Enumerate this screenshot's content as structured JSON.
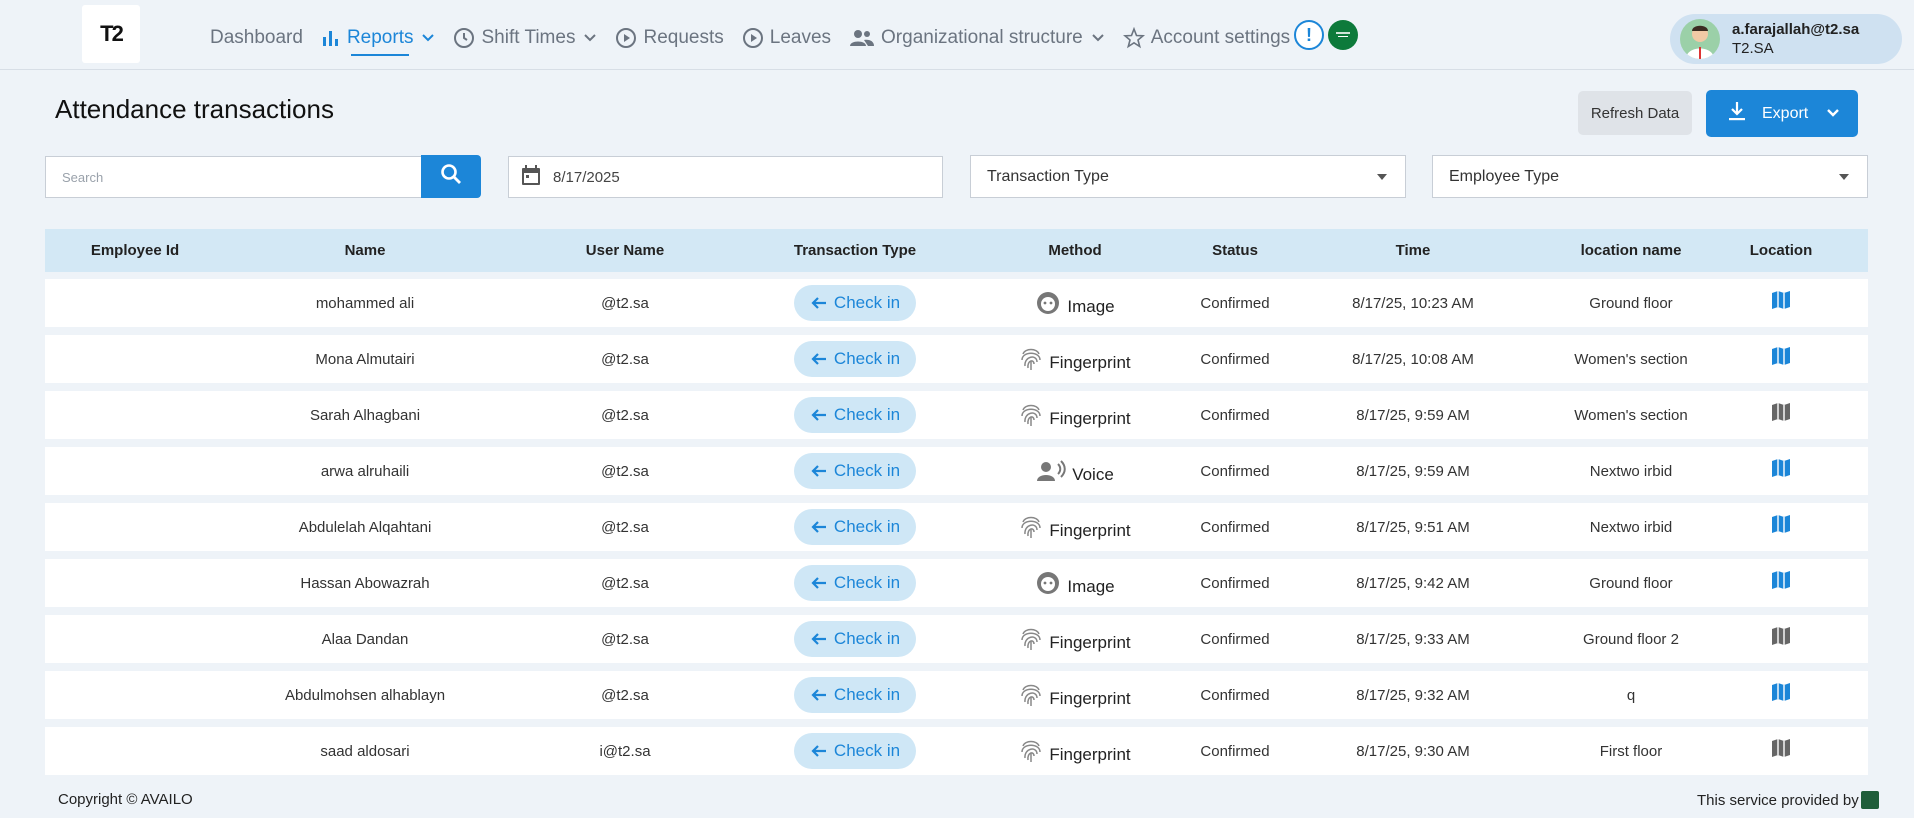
{
  "header": {
    "logo_text": "T2",
    "nav": [
      {
        "label": "Dashboard"
      },
      {
        "label": "Reports"
      },
      {
        "label": "Shift Times"
      },
      {
        "label": "Requests"
      },
      {
        "label": "Leaves"
      },
      {
        "label": "Organizational structure"
      },
      {
        "label": "Account settings"
      }
    ],
    "alert_symbol": "!",
    "user": {
      "email": "a.farajallah@t2.sa",
      "domain": "T2.SA"
    }
  },
  "page": {
    "title": "Attendance transactions",
    "refresh_label": "Refresh Data",
    "export_label": "Export"
  },
  "filters": {
    "search_placeholder": "Search",
    "date_value": "8/17/2025",
    "transaction_type_label": "Transaction Type",
    "employee_type_label": "Employee Type"
  },
  "table": {
    "columns": [
      "Employee Id",
      "Name",
      "User Name",
      "Transaction Type",
      "Method",
      "Status",
      "Time",
      "location name",
      "Location"
    ],
    "rows": [
      {
        "employee_id": "",
        "name": "mohammed ali",
        "username": "@t2.sa",
        "type": "Check in",
        "method": "Image",
        "method_icon": "face-icon",
        "status": "Confirmed",
        "time": "8/17/25, 10:23 AM",
        "location_name": "Ground floor",
        "location_icon": "map-icon",
        "location_color": "#1c86d8"
      },
      {
        "employee_id": "",
        "name": "Mona Almutairi",
        "username": "@t2.sa",
        "type": "Check in",
        "method": "Fingerprint",
        "method_icon": "fingerprint-icon",
        "status": "Confirmed",
        "time": "8/17/25, 10:08 AM",
        "location_name": "Women's section",
        "location_icon": "map-icon",
        "location_color": "#1c86d8"
      },
      {
        "employee_id": "",
        "name": "Sarah Alhagbani",
        "username": "@t2.sa",
        "type": "Check in",
        "method": "Fingerprint",
        "method_icon": "fingerprint-icon",
        "status": "Confirmed",
        "time": "8/17/25, 9:59 AM",
        "location_name": "Women's section",
        "location_icon": "map-icon",
        "location_color": "#666666"
      },
      {
        "employee_id": "",
        "name": "arwa alruhaili",
        "username": "@t2.sa",
        "type": "Check in",
        "method": "Voice",
        "method_icon": "voice-icon",
        "status": "Confirmed",
        "time": "8/17/25, 9:59 AM",
        "location_name": "Nextwo irbid",
        "location_icon": "map-icon",
        "location_color": "#1c86d8"
      },
      {
        "employee_id": "",
        "name": "Abdulelah Alqahtani",
        "username": "@t2.sa",
        "type": "Check in",
        "method": "Fingerprint",
        "method_icon": "fingerprint-icon",
        "status": "Confirmed",
        "time": "8/17/25, 9:51 AM",
        "location_name": "Nextwo irbid",
        "location_icon": "map-icon",
        "location_color": "#1c86d8"
      },
      {
        "employee_id": "",
        "name": "Hassan Abowazrah",
        "username": "@t2.sa",
        "type": "Check in",
        "method": "Image",
        "method_icon": "face-icon",
        "status": "Confirmed",
        "time": "8/17/25, 9:42 AM",
        "location_name": "Ground floor",
        "location_icon": "map-icon",
        "location_color": "#1c86d8"
      },
      {
        "employee_id": "",
        "name": "Alaa Dandan",
        "username": "@t2.sa",
        "type": "Check in",
        "method": "Fingerprint",
        "method_icon": "fingerprint-icon",
        "status": "Confirmed",
        "time": "8/17/25, 9:33 AM",
        "location_name": "Ground floor 2",
        "location_icon": "map-icon",
        "location_color": "#666666"
      },
      {
        "employee_id": "",
        "name": "Abdulmohsen alhablayn",
        "username": "@t2.sa",
        "type": "Check in",
        "method": "Fingerprint",
        "method_icon": "fingerprint-icon",
        "status": "Confirmed",
        "time": "8/17/25, 9:32 AM",
        "location_name": "q",
        "location_icon": "map-icon",
        "location_color": "#1c86d8"
      },
      {
        "employee_id": "",
        "name": "saad aldosari",
        "username": "i@t2.sa",
        "type": "Check in",
        "method": "Fingerprint",
        "method_icon": "fingerprint-icon",
        "status": "Confirmed",
        "time": "8/17/25, 9:30 AM",
        "location_name": "First floor",
        "location_icon": "map-icon",
        "location_color": "#666666"
      }
    ]
  },
  "footer": {
    "copyright": "Copyright © AVAILO",
    "provided_by": "This service provided by"
  },
  "colors": {
    "accent": "#1c86d8",
    "header_bg": "#d3e8f5",
    "page_bg": "#eef3f8"
  }
}
